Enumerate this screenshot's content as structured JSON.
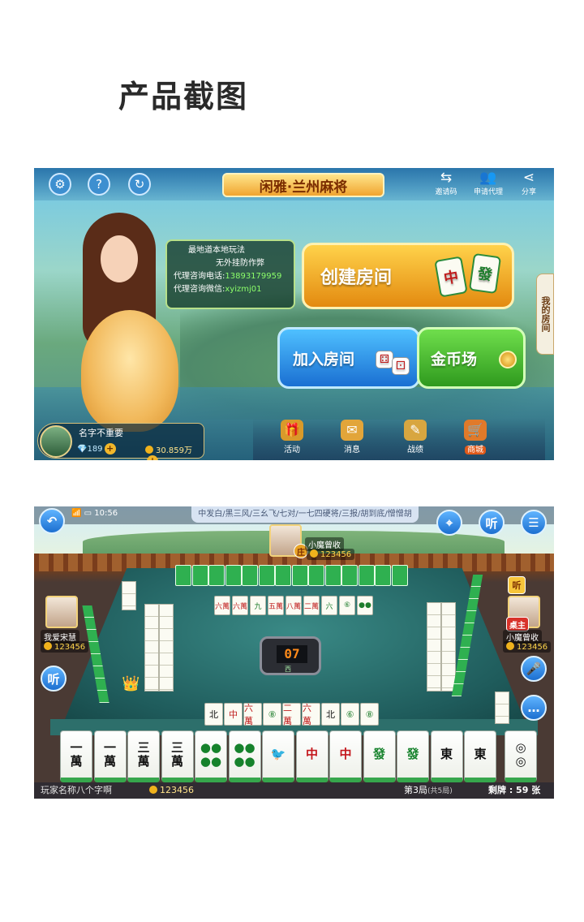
{
  "page_title": "产品截图",
  "lobby": {
    "title": "闲雅·兰州麻将",
    "top_right": [
      {
        "label": "邀请码",
        "icon": "invite-icon"
      },
      {
        "label": "申请代理",
        "icon": "agent-icon"
      },
      {
        "label": "分享",
        "icon": "share-icon"
      }
    ],
    "side_tab": "我的房间",
    "bubble": {
      "line1": "最地道本地玩法",
      "line2": "无外挂防作弊",
      "phone_label": "代理咨询电话:",
      "phone": "13893179959",
      "wechat_label": "代理咨询微信:",
      "wechat": "xyizmj01"
    },
    "buttons": {
      "create": "创建房间",
      "join": "加入房间",
      "coin": "金币场"
    },
    "bottom_nav": [
      {
        "label": "活动",
        "icon": "gift-icon"
      },
      {
        "label": "消息",
        "icon": "mail-icon"
      },
      {
        "label": "战绩",
        "icon": "record-icon"
      },
      {
        "label": "商城",
        "icon": "cart-icon"
      }
    ],
    "player": {
      "name": "名字不重要",
      "gems": "189",
      "coins": "30.859万"
    }
  },
  "table": {
    "time": "10:56",
    "rules": "中发白/黑三风/三幺飞/七对/一七四硬将/三报/胡到底/憎憎胡",
    "dial_number": "07",
    "dial_dir": "西",
    "players": {
      "top": {
        "name": "小魔曾收",
        "coins": "123456",
        "banker": "庄"
      },
      "left": {
        "name": "我爱宋慧",
        "coins": "123456"
      },
      "right": {
        "name": "小魔曾收",
        "coins": "123456",
        "badge": "桌主"
      }
    },
    "ting_label": "听",
    "left_ting": "听",
    "discards_top": [
      "六萬",
      "六萬",
      "九",
      "五萬",
      "八萬",
      "二萬",
      "六",
      "⑥",
      "●●"
    ],
    "discards_bottom": [
      "北",
      "中",
      "六萬",
      "⑧",
      "二萬",
      "六萬",
      "北",
      "⑥",
      "⑧"
    ],
    "hand": [
      {
        "t": "一\n萬",
        "c": "black"
      },
      {
        "t": "一\n萬",
        "c": "black"
      },
      {
        "t": "三\n萬",
        "c": "black"
      },
      {
        "t": "三\n萬",
        "c": "black"
      },
      {
        "t": "●●\n●●",
        "c": "green"
      },
      {
        "t": "●●\n●●",
        "c": "green"
      },
      {
        "t": "🐦",
        "c": "green"
      },
      {
        "t": "中",
        "c": "red"
      },
      {
        "t": "中",
        "c": "red"
      },
      {
        "t": "發",
        "c": "green"
      },
      {
        "t": "發",
        "c": "green"
      },
      {
        "t": "東",
        "c": "black"
      },
      {
        "t": "東",
        "c": "black"
      }
    ],
    "drawn": {
      "t": "◎\n◎",
      "c": "black"
    },
    "footer": {
      "player_name": "玩家名称八个字啊",
      "coins": "123456",
      "round": "第3局",
      "round_total": "(共5局)",
      "remaining": "剩牌 : 59 张"
    }
  }
}
